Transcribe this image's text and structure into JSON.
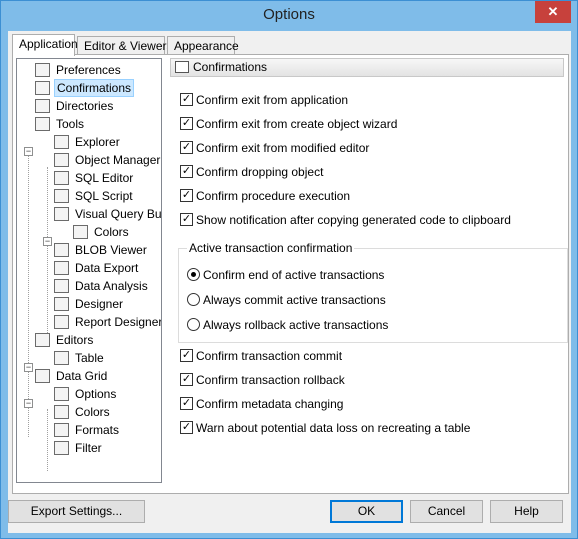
{
  "window": {
    "title": "Options",
    "close_label": "✕"
  },
  "tabs": [
    {
      "label": "Application",
      "active": true
    },
    {
      "label": "Editor & Viewers",
      "active": false
    },
    {
      "label": "Appearance",
      "active": false
    }
  ],
  "tree": {
    "items": [
      {
        "label": "Preferences",
        "icon": "preferences-icon"
      },
      {
        "label": "Confirmations",
        "icon": "confirmations-icon",
        "selected": true
      },
      {
        "label": "Directories",
        "icon": "folder-icon"
      },
      {
        "label": "Tools",
        "icon": "tools-icon"
      },
      {
        "label": "Explorer",
        "icon": "explorer-icon"
      },
      {
        "label": "Object Manager",
        "icon": "object-manager-icon"
      },
      {
        "label": "SQL Editor",
        "icon": "sql-editor-icon"
      },
      {
        "label": "SQL Script",
        "icon": "sql-script-icon"
      },
      {
        "label": "Visual Query Buil",
        "icon": "visual-query-icon"
      },
      {
        "label": "Colors",
        "icon": "colors-grid-icon"
      },
      {
        "label": "BLOB Viewer",
        "icon": "blob-viewer-icon"
      },
      {
        "label": "Data Export",
        "icon": "data-export-icon"
      },
      {
        "label": "Data Analysis",
        "icon": "data-analysis-icon"
      },
      {
        "label": "Designer",
        "icon": "designer-icon"
      },
      {
        "label": "Report Designer",
        "icon": "report-designer-icon"
      },
      {
        "label": "Editors",
        "icon": "editors-icon"
      },
      {
        "label": "Table",
        "icon": "table-icon"
      },
      {
        "label": "Data Grid",
        "icon": "data-grid-icon"
      },
      {
        "label": "Options",
        "icon": "options-icon"
      },
      {
        "label": "Colors",
        "icon": "colors-icon"
      },
      {
        "label": "Formats",
        "icon": "formats-icon"
      },
      {
        "label": "Filter",
        "icon": "filter-icon"
      }
    ]
  },
  "section": {
    "title": "Confirmations"
  },
  "checks_top": [
    {
      "label": "Confirm exit from application",
      "checked": true
    },
    {
      "label": "Confirm exit from create object wizard",
      "checked": true
    },
    {
      "label": "Confirm exit from modified editor",
      "checked": true
    },
    {
      "label": "Confirm dropping object",
      "checked": true
    },
    {
      "label": "Confirm procedure execution",
      "checked": true
    },
    {
      "label": "Show notification after copying generated code to clipboard",
      "checked": true
    }
  ],
  "transaction_group": {
    "title": "Active transaction confirmation",
    "options": [
      {
        "label": "Confirm end of active transactions",
        "selected": true
      },
      {
        "label": "Always commit active transactions",
        "selected": false
      },
      {
        "label": "Always rollback active transactions",
        "selected": false
      }
    ]
  },
  "checks_bottom": [
    {
      "label": "Confirm transaction commit",
      "checked": true
    },
    {
      "label": "Confirm transaction rollback",
      "checked": true
    },
    {
      "label": "Confirm metadata changing",
      "checked": true
    },
    {
      "label": "Warn about potential data loss on recreating a table",
      "checked": true
    }
  ],
  "buttons": {
    "export": "Export Settings...",
    "ok": "OK",
    "cancel": "Cancel",
    "help": "Help"
  },
  "colors": {
    "titlebar": "#7fbce9",
    "close": "#c7413c",
    "selection": "#cce8ff"
  }
}
